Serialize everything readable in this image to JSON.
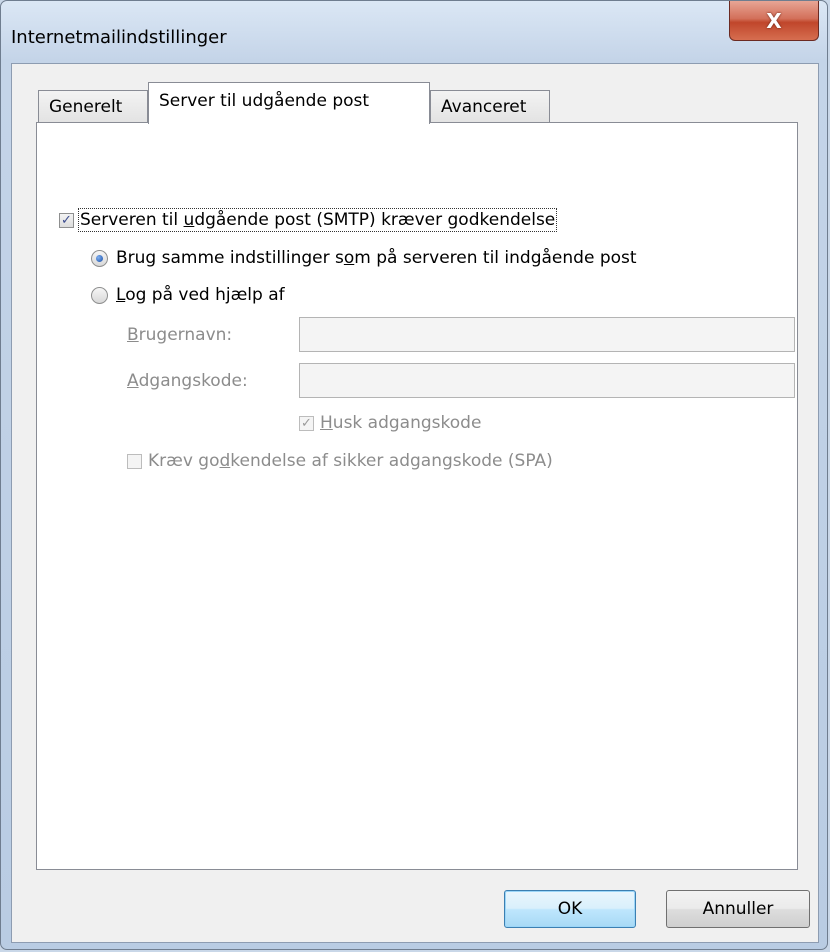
{
  "window": {
    "title": "Internetmailindstillinger",
    "close_label": "X"
  },
  "tabs": [
    {
      "label": "Generelt",
      "active": false
    },
    {
      "label": "Server til udgående post",
      "active": true
    },
    {
      "label": "Avanceret",
      "active": false
    }
  ],
  "panel": {
    "smtp_auth": {
      "pre": "Serveren til ",
      "ul": "u",
      "post": "dgående post (SMTP) kræver godkendelse",
      "checked": true
    },
    "same_settings": {
      "pre": "Brug samme indstillinger s",
      "ul": "o",
      "post": "m på serveren til indgående post",
      "selected": true
    },
    "log_on_with": {
      "pre": "",
      "ul": "L",
      "post": "og på ved hjælp af",
      "selected": false
    },
    "username": {
      "ul": "B",
      "post": "rugernavn:",
      "value": ""
    },
    "password": {
      "ul": "A",
      "post": "dgangskode:",
      "value": ""
    },
    "remember_password": {
      "ul": "H",
      "post": "usk adgangskode",
      "checked": true
    },
    "spa": {
      "pre": "Kræv go",
      "ul": "d",
      "post": "kendelse af sikker adgangskode (SPA)",
      "checked": false
    }
  },
  "buttons": {
    "ok": "OK",
    "cancel": "Annuller"
  }
}
